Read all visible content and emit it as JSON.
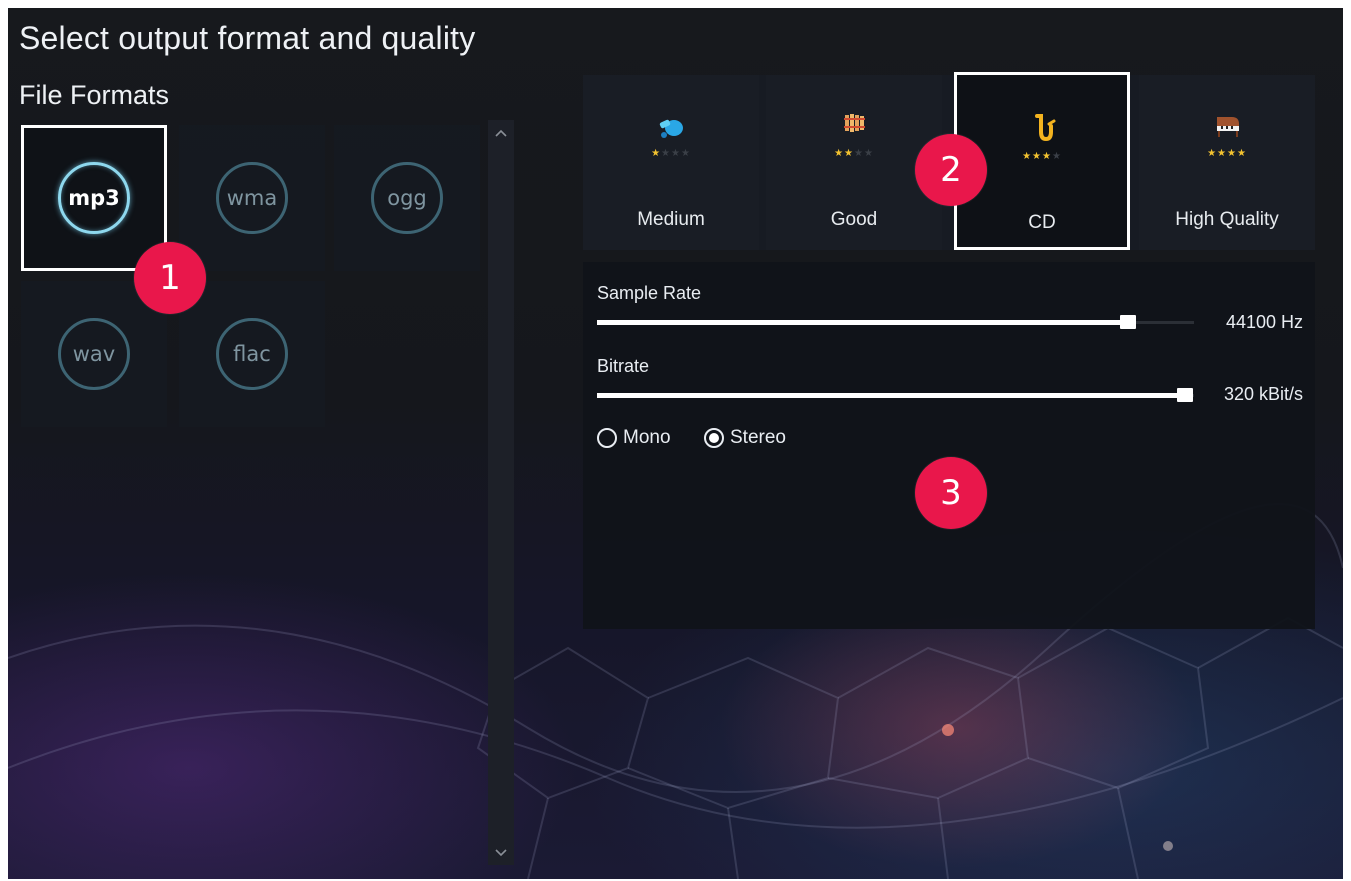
{
  "title": "Select output format and quality",
  "file_formats": {
    "heading": "File Formats",
    "items": [
      {
        "label": "mp3",
        "selected": true
      },
      {
        "label": "wma",
        "selected": false
      },
      {
        "label": "ogg",
        "selected": false
      },
      {
        "label": "wav",
        "selected": false
      },
      {
        "label": "flac",
        "selected": false
      }
    ],
    "scroll_up_glyph": "^",
    "scroll_down_glyph": "v"
  },
  "quality": {
    "presets": [
      {
        "label": "Medium",
        "rating": 1,
        "max_rating": 4,
        "icon": "whistle-icon",
        "selected": false
      },
      {
        "label": "Good",
        "rating": 2,
        "max_rating": 4,
        "icon": "xylophone-icon",
        "selected": false
      },
      {
        "label": "CD",
        "rating": 3,
        "max_rating": 4,
        "icon": "saxophone-icon",
        "selected": true
      },
      {
        "label": "High Quality",
        "rating": 4,
        "max_rating": 4,
        "icon": "grand-piano-icon",
        "selected": false
      }
    ]
  },
  "settings": {
    "sample_rate": {
      "label": "Sample Rate",
      "value": "44100 Hz",
      "fraction": 0.9
    },
    "bitrate": {
      "label": "Bitrate",
      "value": "320 kBit/s",
      "fraction": 1.0
    },
    "channels": {
      "options": [
        {
          "label": "Mono",
          "checked": false
        },
        {
          "label": "Stereo",
          "checked": true
        }
      ]
    }
  },
  "annotations": [
    "1",
    "2",
    "3"
  ],
  "colors": {
    "badge": "#e9174b",
    "star_on": "#f2c230",
    "ring_selected": "#8ed8ee",
    "ring_idle": "#3d6473"
  }
}
